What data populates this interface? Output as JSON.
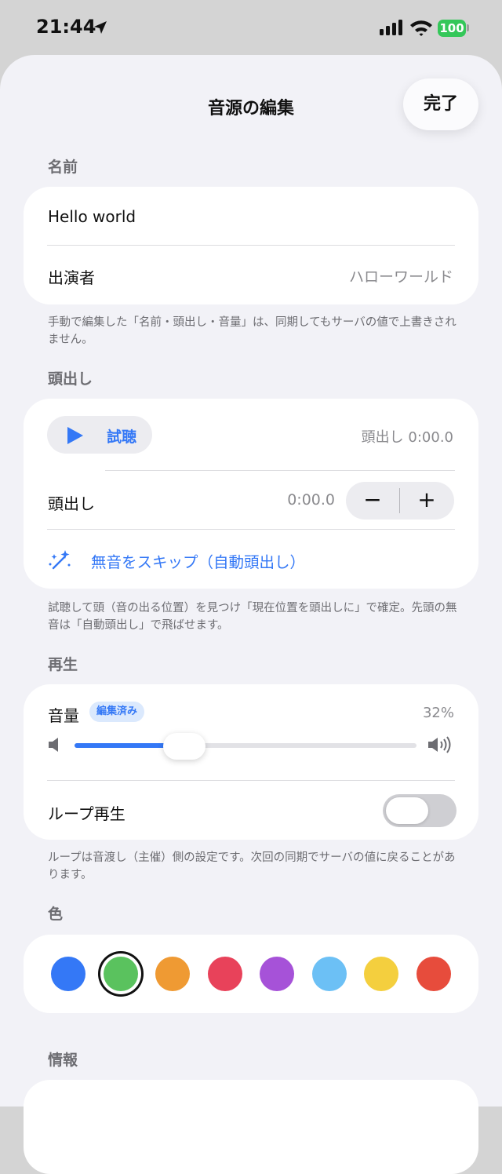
{
  "status_bar": {
    "time": "21:44",
    "battery": "100"
  },
  "nav": {
    "title": "音源の編集",
    "done_label": "完了"
  },
  "name_section": {
    "label": "名前",
    "name_value": "Hello world",
    "performer_label": "出演者",
    "performer_placeholder": "ハローワールド",
    "footnote": "手動で編集した「名前・頭出し・音量」は、同期してもサーバの値で上書きされません。"
  },
  "cue_section": {
    "label": "頭出し",
    "listen_label": "試聴",
    "cue_readout": "頭出し 0:00.0",
    "cue_row_label": "頭出し",
    "cue_value": "0:00.0",
    "minus_label": "−",
    "plus_label": "+",
    "skip_label": "無音をスキップ（自動頭出し）",
    "footnote": "試聴して頭（音の出る位置）を見つけ「現在位置を頭出しに」で確定。先頭の無音は「自動頭出し」で飛ばせます。"
  },
  "playback_section": {
    "label": "再生",
    "volume_label": "音量",
    "edited_badge": "編集済み",
    "volume_percent": "32%",
    "volume_level": 0.32,
    "loop_label": "ループ再生",
    "loop_on": false,
    "footnote": "ループは音渡し（主催）側の設定です。次回の同期でサーバの値に戻ることがあります。"
  },
  "color_section": {
    "label": "色",
    "swatches": [
      {
        "name": "blue",
        "hex": "#3478f6",
        "selected": false
      },
      {
        "name": "green",
        "hex": "#5ac25e",
        "selected": true
      },
      {
        "name": "orange",
        "hex": "#ef9a33",
        "selected": false
      },
      {
        "name": "red-pink",
        "hex": "#e8425a",
        "selected": false
      },
      {
        "name": "purple",
        "hex": "#a652d8",
        "selected": false
      },
      {
        "name": "light-blue",
        "hex": "#6cc0f5",
        "selected": false
      },
      {
        "name": "yellow",
        "hex": "#f4cf3e",
        "selected": false
      },
      {
        "name": "red",
        "hex": "#e74c3c",
        "selected": false
      }
    ]
  },
  "info_section": {
    "label": "情報"
  },
  "colors": {
    "accent": "#3478f6",
    "battery": "#34c759"
  }
}
